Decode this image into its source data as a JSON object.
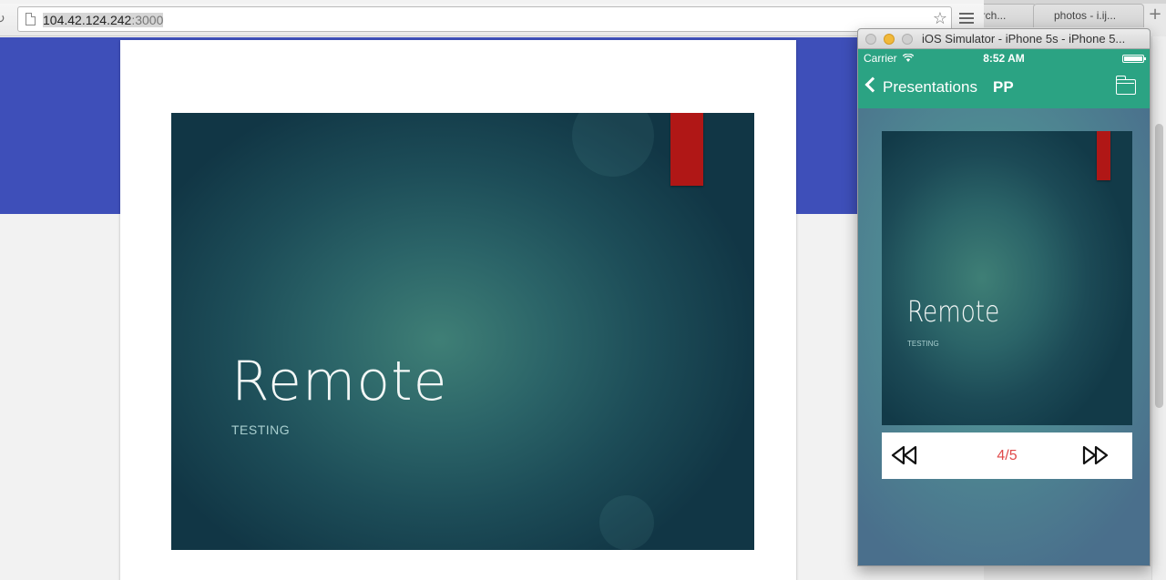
{
  "browser": {
    "url_host": "104.42.124.242",
    "url_port": ":3000",
    "tabs": [
      "urch...",
      "photos - i.ij..."
    ]
  },
  "main_slide": {
    "title": "Remote",
    "subtitle": "TESTING"
  },
  "simulator": {
    "window_title": "iOS Simulator - iPhone 5s - iPhone 5...",
    "status": {
      "carrier": "Carrier",
      "time": "8:52 AM"
    },
    "nav": {
      "back_label": "Presentations",
      "title": "PP"
    },
    "slide": {
      "title": "Remote",
      "subtitle": "TESTING"
    },
    "counter": "4/5"
  },
  "colors": {
    "blue_band": "#3e4fb9",
    "nav_green": "#2ba383",
    "ribbon_red": "#b01716",
    "counter_red": "#e04a4a"
  },
  "icons": [
    "reload-icon",
    "page-icon",
    "bookmark-star-icon",
    "menu-icon",
    "back-chevron-icon",
    "folder-icon",
    "rewind-icon",
    "fast-forward-icon",
    "wifi-icon",
    "battery-icon"
  ]
}
